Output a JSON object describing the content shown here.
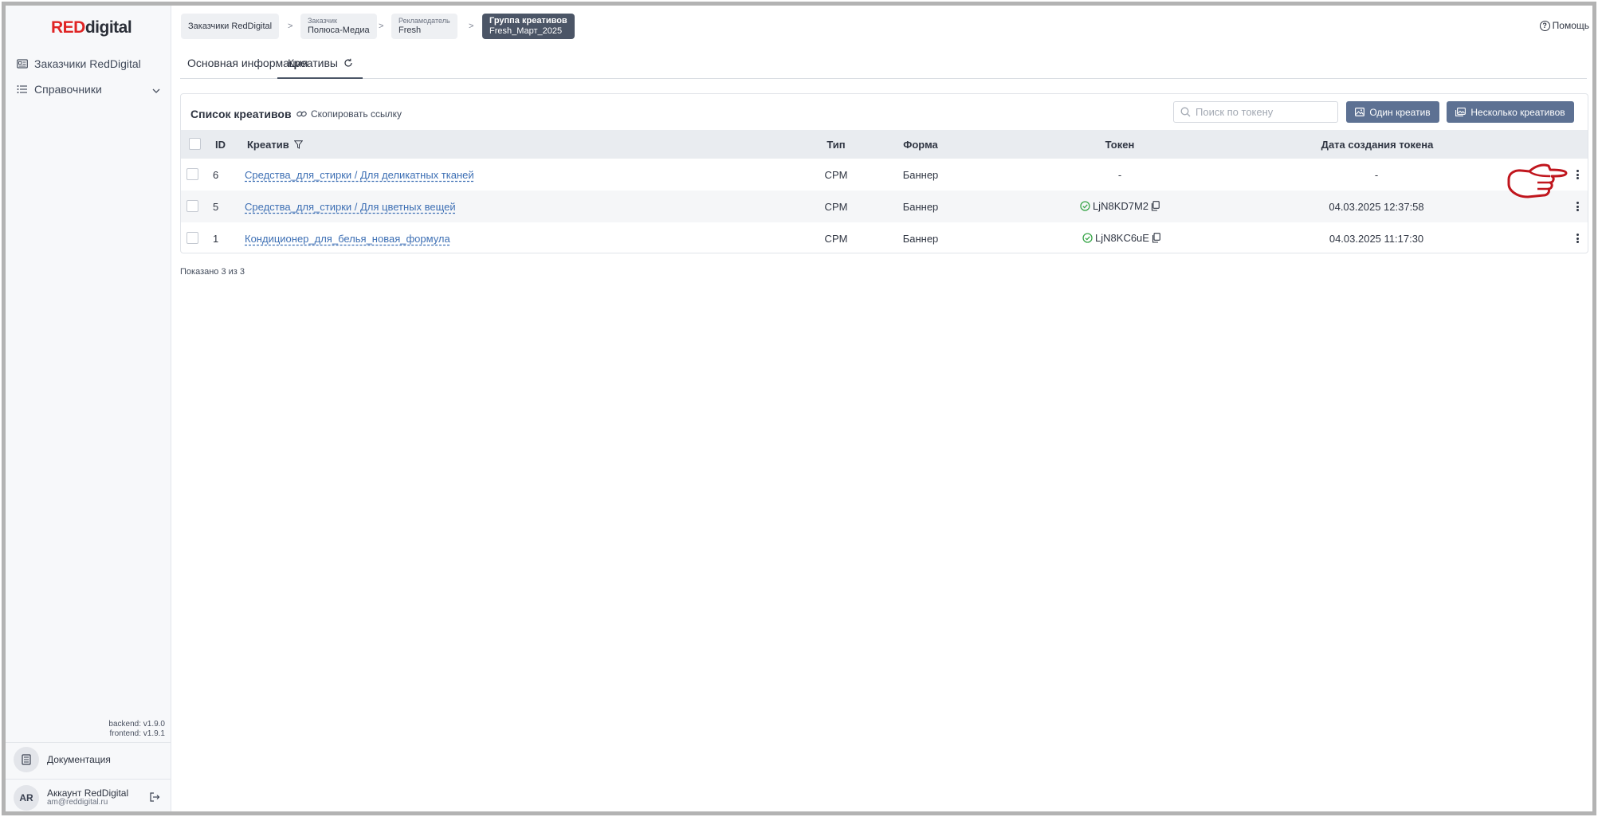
{
  "brand": {
    "logo_red": "RED",
    "logo_rest": "digital"
  },
  "sidebar": {
    "items": [
      {
        "label": "Заказчики RedDigital",
        "icon": "id-card-icon"
      },
      {
        "label": "Справочники",
        "icon": "list-icon"
      }
    ],
    "versions": {
      "backend": "backend: v1.9.0",
      "frontend": "frontend: v1.9.1"
    },
    "docs_label": "Документация",
    "account": {
      "initials": "AR",
      "name": "Аккаунт RedDigital",
      "email": "am@reddigital.ru"
    }
  },
  "breadcrumbs": [
    {
      "small": "",
      "big": "Заказчики RedDigital"
    },
    {
      "small": "Заказчик",
      "big": "Полюса-Медиа"
    },
    {
      "small": "Рекламодатель",
      "big": "Fresh"
    },
    {
      "small": "Группа креативов",
      "big": "Fresh_Март_2025"
    }
  ],
  "help_label": "Помощь",
  "tabs": [
    {
      "label": "Основная информация"
    },
    {
      "label": "Креативы"
    }
  ],
  "list": {
    "title": "Список креативов",
    "copy_link": "Скопировать ссылку",
    "search_placeholder": "Поиск по токену",
    "btn_single": "Один креатив",
    "btn_multi": "Несколько креативов",
    "columns": {
      "id": "ID",
      "creative": "Креатив",
      "type": "Тип",
      "form": "Форма",
      "token": "Токен",
      "date": "Дата создания токена"
    },
    "rows": [
      {
        "id": "6",
        "name": "Средства_для_стирки / Для деликатных тканей",
        "type": "CPM",
        "form": "Баннер",
        "token": "-",
        "date": "-"
      },
      {
        "id": "5",
        "name": "Средства_для_стирки / Для цветных вещей",
        "type": "CPM",
        "form": "Баннер",
        "token": "LjN8KD7M2",
        "date": "04.03.2025 12:37:58"
      },
      {
        "id": "1",
        "name": "Кондиционер_для_белья_новая_формула",
        "type": "CPM",
        "form": "Баннер",
        "token": "LjN8KC6uE",
        "date": "04.03.2025 11:17:30"
      }
    ],
    "shown": "Показано 3 из 3"
  },
  "colors": {
    "accent": "#5d7193",
    "brand_red": "#e02424",
    "link": "#3d6fb4",
    "success": "#3aa64a",
    "pointer": "#c0161e"
  }
}
